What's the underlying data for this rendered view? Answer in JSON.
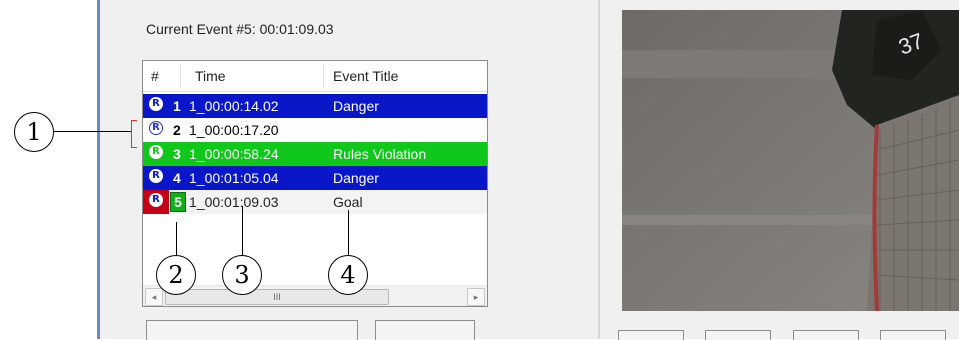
{
  "header": {
    "current_event_label": "Current Event #5: 00:01:09.03"
  },
  "event_list": {
    "columns": [
      "#",
      "Time",
      "Event Title"
    ],
    "rows": [
      {
        "icon": "R",
        "number": "1",
        "time": "1_00:00:14.02",
        "title": "Danger",
        "color": "#0a17c9"
      },
      {
        "icon": "R",
        "number": "2",
        "time": "1_00:00:17.20",
        "title": "",
        "color": "#ffffff"
      },
      {
        "icon": "R",
        "number": "3",
        "time": "1_00:00:58.24",
        "title": "Rules Violation",
        "color": "#10c81b"
      },
      {
        "icon": "R",
        "number": "4",
        "time": "1_00:01:05.04",
        "title": "Danger",
        "color": "#0a17c9"
      },
      {
        "icon": "R",
        "number": "5",
        "time": "1_00:01:09.03",
        "title": "Goal",
        "color": "#f3f3f3"
      }
    ],
    "scrollbar": {
      "left_arrow": "◂",
      "right_arrow": "▸",
      "thumb_grip": "III"
    }
  },
  "callouts": [
    "1",
    "2",
    "3",
    "4"
  ],
  "video": {
    "description_icon": "video-preview"
  }
}
